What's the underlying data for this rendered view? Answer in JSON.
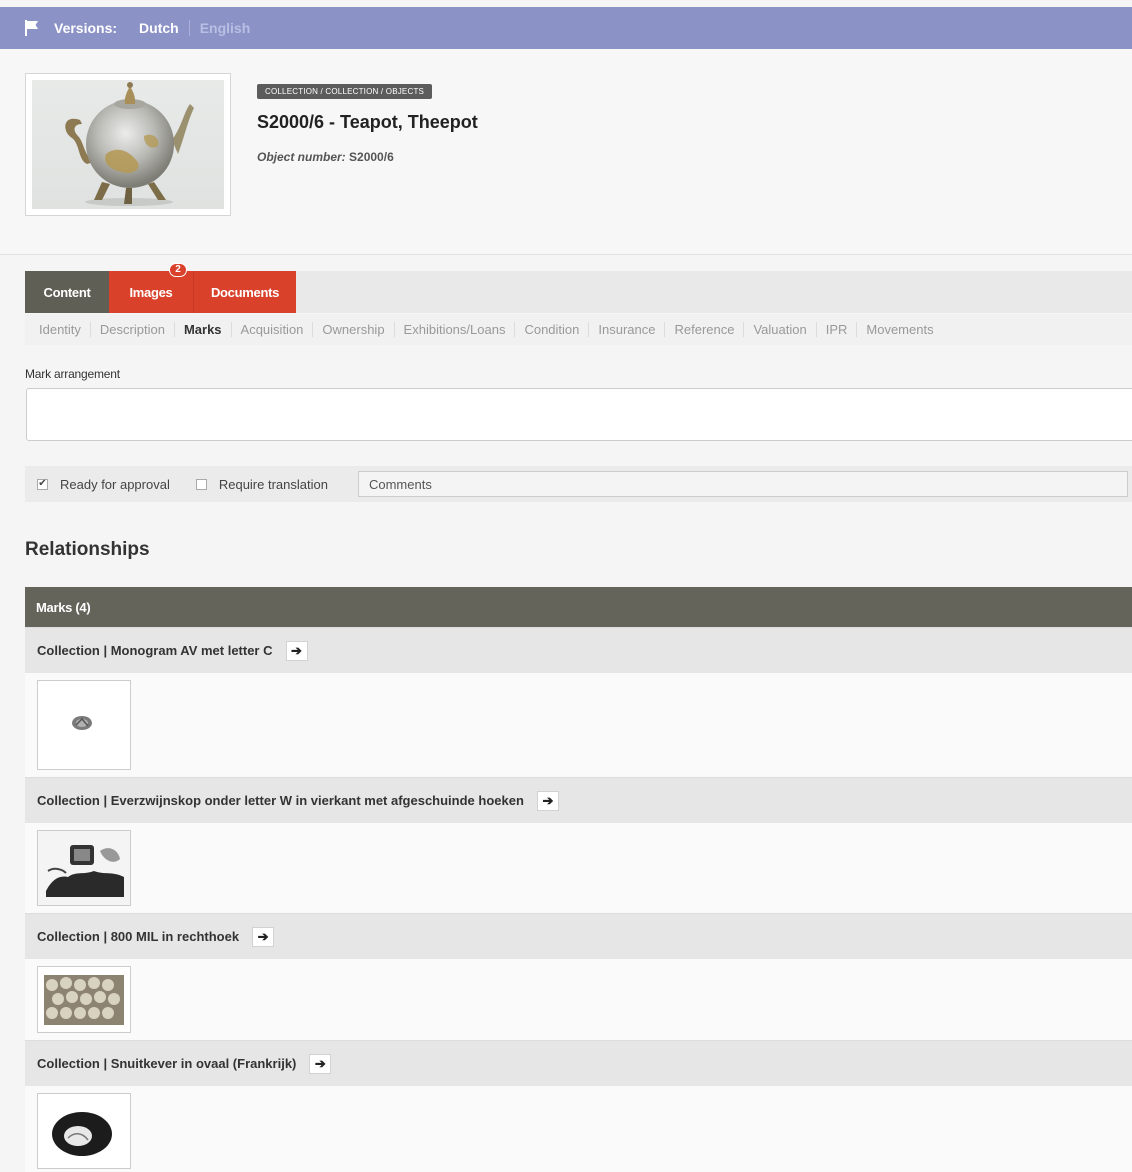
{
  "versions": {
    "label": "Versions:",
    "dutch": "Dutch",
    "english": "English"
  },
  "object": {
    "breadcrumb": "COLLECTION / COLLECTION / OBJECTS",
    "title": "S2000/6 - Teapot, Theepot",
    "number_label": "Object number:",
    "number_value": "S2000/6"
  },
  "tabs": {
    "content": "Content",
    "images": "Images",
    "images_count": "2",
    "documents": "Documents"
  },
  "subtabs": [
    "Identity",
    "Description",
    "Marks",
    "Acquisition",
    "Ownership",
    "Exhibitions/Loans",
    "Condition",
    "Insurance",
    "Reference",
    "Valuation",
    "IPR",
    "Movements"
  ],
  "active_subtab": "Marks",
  "field": {
    "label": "Mark arrangement",
    "value": ""
  },
  "approval": {
    "ready_label": "Ready for approval",
    "ready_checked": true,
    "translation_label": "Require translation",
    "translation_checked": false,
    "comments_placeholder": "Comments"
  },
  "relationships": {
    "heading": "Relationships",
    "marks_header": "Marks (4)",
    "items": [
      {
        "label": "Collection | Monogram AV met letter C",
        "image": "monogram-mark-photo"
      },
      {
        "label": "Collection | Everzwijnskop onder letter W in vierkant met afgeschuinde hoeken",
        "image": "boar-head-mark-photo"
      },
      {
        "label": "Collection | 800 MIL in rechthoek",
        "image": "800-mil-mark-photo"
      },
      {
        "label": "Collection | Snuitkever in ovaal (Frankrijk)",
        "image": "weevil-mark-photo"
      }
    ]
  },
  "icons": {
    "flag": "flag-icon",
    "arrow": "arrow-right-icon",
    "check": "checkmark-icon"
  }
}
